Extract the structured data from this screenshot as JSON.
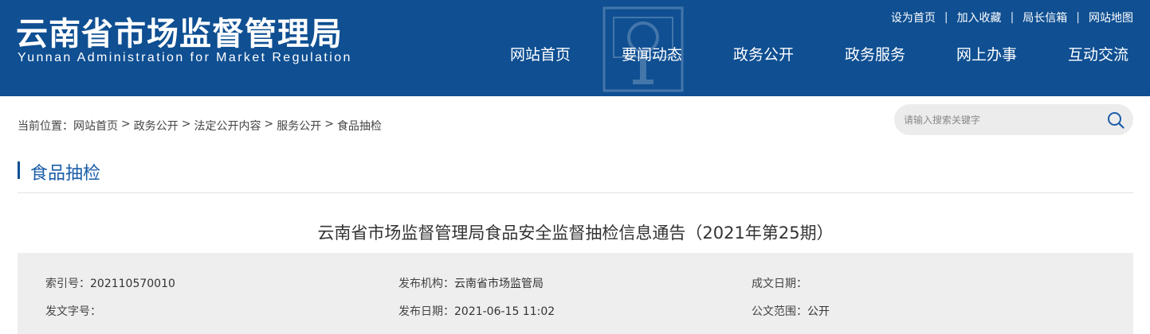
{
  "header": {
    "title": "云南省市场监督管理局",
    "subtitle": "Yunnan Administration for Market Regulation",
    "top_links": [
      "设为首页",
      "加入收藏",
      "局长信箱",
      "网站地图"
    ],
    "top_link_separator": "|",
    "nav": [
      "网站首页",
      "要闻动态",
      "政务公开",
      "政务服务",
      "网上办事",
      "互动交流"
    ]
  },
  "breadcrumb": {
    "prefix": "当前位置：",
    "items": [
      "网站首页",
      "政务公开",
      "法定公开内容",
      "服务公开",
      "食品抽检"
    ],
    "separator": ">"
  },
  "search": {
    "placeholder": "请输入搜索关键字"
  },
  "section": {
    "title": "食品抽检"
  },
  "article": {
    "title": "云南省市场监督管理局食品安全监督抽检信息通告（2021年第25期）",
    "meta": {
      "index_label": "索引号：",
      "index_value": "202110570010",
      "publisher_label": "发布机构：",
      "publisher_value": "云南省市场监管局",
      "created_label": "成文日期：",
      "created_value": "",
      "doc_no_label": "发文字号：",
      "doc_no_value": "",
      "pub_date_label": "发布日期：",
      "pub_date_value": "2021-06-15 11:02",
      "scope_label": "公文范围：",
      "scope_value": "公开"
    }
  },
  "colors": {
    "header_bg": "#0f4f92",
    "accent": "#1a5da8",
    "meta_bg": "#eeeeee",
    "search_bg": "#ececec"
  }
}
